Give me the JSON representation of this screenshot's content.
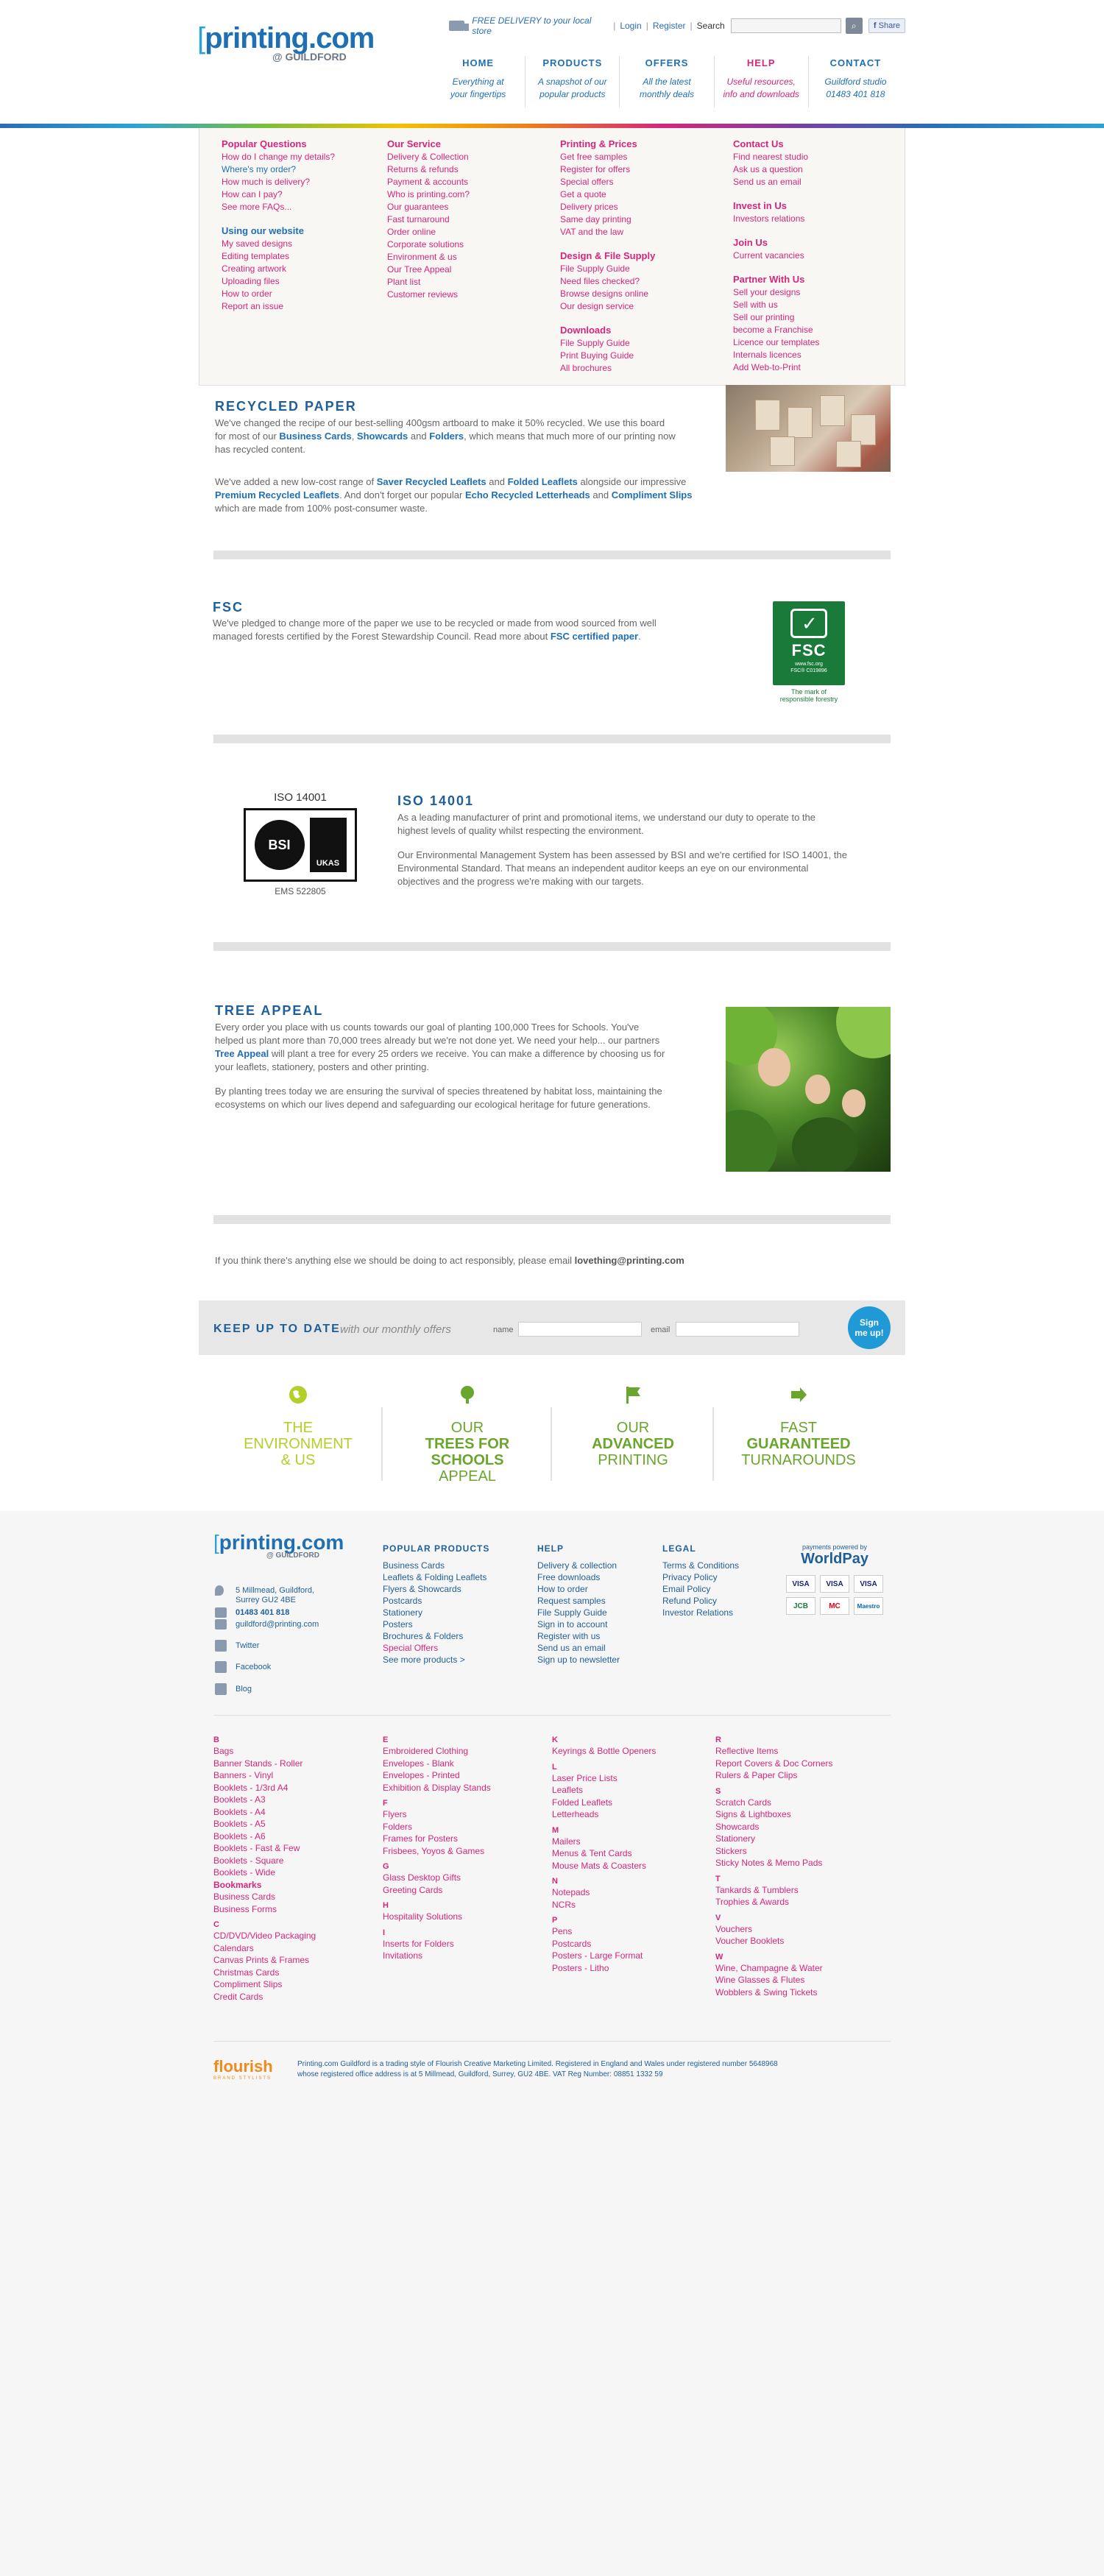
{
  "header": {
    "delivery": "FREE DELIVERY to your local store",
    "login": "Login",
    "register": "Register",
    "search_label": "Search",
    "share": "Share",
    "logo_word": "printing.com",
    "logo_bracket": "[",
    "logo_sub": "@ GUILDFORD"
  },
  "nav": [
    {
      "title": "HOME",
      "sub1": "Everything at",
      "sub2": "your fingertips"
    },
    {
      "title": "PRODUCTS",
      "sub1": "A snapshot of our",
      "sub2": "popular products"
    },
    {
      "title": "OFFERS",
      "sub1": "All the latest",
      "sub2": "monthly deals"
    },
    {
      "title": "HELP",
      "sub1": "Useful resources,",
      "sub2": "info and downloads"
    },
    {
      "title": "CONTACT",
      "sub1": "Guildford studio",
      "sub2": "01483 401 818"
    }
  ],
  "mega": {
    "popular_title": "Popular Questions",
    "popular": [
      "How do I change my details?",
      "Where's my order?",
      "How much is delivery?",
      "How can I pay?",
      "See more FAQs..."
    ],
    "website_title": "Using our website",
    "website": [
      "My saved designs",
      "Editing templates",
      "Creating artwork",
      "Uploading files",
      "How to order",
      "Report an issue"
    ],
    "service_title": "Our Service",
    "service": [
      "Delivery & Collection",
      "Returns & refunds",
      "Payment & accounts",
      "Who is printing.com?",
      "Our guarantees",
      "Fast turnaround",
      "Order online",
      "Corporate solutions",
      "Environment & us",
      "Our Tree Appeal",
      "Plant list",
      "Customer reviews"
    ],
    "prices_title": "Printing & Prices",
    "prices": [
      "Get free samples",
      "Register for offers",
      "Special offers",
      "Get a quote",
      "Delivery prices",
      "Same day printing",
      "VAT and the law"
    ],
    "design_title": "Design & File Supply",
    "design": [
      "File Supply Guide",
      "Need files checked?",
      "Browse designs online",
      "Our design service"
    ],
    "downloads_title": "Downloads",
    "downloads": [
      "File Supply Guide",
      "Print Buying Guide",
      "All brochures"
    ],
    "contact_title": "Contact Us",
    "contact": [
      "Find nearest studio",
      "Ask us a question",
      "Send us an email"
    ],
    "invest_title": "Invest in Us",
    "invest": [
      "Investors relations"
    ],
    "join_title": "Join Us",
    "join": [
      "Current vacancies"
    ],
    "partner_title": "Partner With Us",
    "partner": [
      "Sell your designs",
      "Sell with us",
      "Sell our printing",
      "become a Franchise",
      "Licence our templates",
      "Internals licences",
      "Add Web-to-Print"
    ]
  },
  "recycled": {
    "title": "RECYCLED PAPER",
    "p1a": "We've changed the recipe of our best-selling 400gsm artboard to make it 50% recycled. We use this board",
    "p1b": "for most of our ",
    "l1": "Business Cards",
    "c1": ", ",
    "l2": "Showcards",
    "c2": " and ",
    "l3": "Folders",
    "p1c": ", which means that much more of our printing now",
    "p1d": "has recycled content.",
    "p2a": "We've added a new low-cost range of ",
    "l4": "Saver Recycled Leaflets",
    "c3": " and ",
    "l5": "Folded Leaflets",
    "p2b": " alongside our impressive",
    "l6": "Premium Recycled Leaflets",
    "p2c": ". And don't forget our popular ",
    "l7": "Echo Recycled Letterheads",
    "c4": " and ",
    "l8": "Compliment Slips",
    "p2d": "which are made from 100% post-consumer waste."
  },
  "fsc": {
    "title": "FSC",
    "p1": "We've pledged to change more of the paper we use to be recycled or made from wood sourced from well",
    "p2a": "managed forests certified by the Forest Stewardship Council. Read more about ",
    "link": "FSC certified paper",
    "p2b": ".",
    "logo_text": "FSC",
    "logo_small": "www.fsc.org",
    "logo_code": "FSC® C019896",
    "caption1": "The mark of",
    "caption2": "responsible forestry"
  },
  "iso": {
    "title": "ISO 14001",
    "logo_caption": "ISO 14001",
    "logo_bsi": "BSI",
    "logo_ukas": "UKAS",
    "ems": "EMS 522805",
    "p1a": "As a leading manufacturer of print and promotional items, we understand our duty to operate to the",
    "p1b": "highest levels of quality whilst respecting the environment.",
    "p2a": "Our Environmental Management System has been assessed by BSI and we're certified for ISO 14001, the",
    "p2b": "Environmental Standard. That means an independent auditor keeps an eye on our environmental",
    "p2c": "objectives and the progress we're making with our targets."
  },
  "tree": {
    "title": "TREE APPEAL",
    "p1a": "Every order you place with us counts towards our goal of planting 100,000 Trees for Schools. You've",
    "p1b": "helped us plant more than 70,000 trees already but we're not done yet. We need your help... our partners",
    "link": "Tree Appeal",
    "p1c": " will plant a tree for every 25 orders we receive. You can make a difference by choosing us for",
    "p1d": "your leaflets, stationery, posters and other printing.",
    "p2a": "By planting trees today we are ensuring the survival of species threatened by habitat loss, maintaining the",
    "p2b": "ecosystems on which our lives depend and safeguarding our ecological heritage for future generations."
  },
  "email_note": {
    "text": "If you think there's anything else we should be doing to act responsibly, please email ",
    "email": "lovething@printing.com"
  },
  "newsletter": {
    "title": "KEEP UP TO DATE",
    "sub": "with our monthly offers",
    "name_label": "name",
    "email_label": "email",
    "button1": "Sign",
    "button2": "me up!"
  },
  "features": [
    {
      "l1": "THE",
      "l2": "ENVIRONMENT",
      "l3": "& US",
      "color": "#b3cf2a"
    },
    {
      "l1": "OUR",
      "l2": "TREES FOR",
      "l3": "SCHOOLS",
      "l4": "APPEAL",
      "color": "#6aa52e"
    },
    {
      "l1": "OUR",
      "l2": "ADVANCED",
      "l3": "PRINTING",
      "color": "#6aa52e"
    },
    {
      "l1": "FAST",
      "l2": "GUARANTEED",
      "l3": "TURNAROUNDS",
      "color": "#6aa52e"
    }
  ],
  "footer": {
    "logo_word": "printing.com",
    "logo_bracket": "[",
    "logo_sub": "@ GUILDFORD",
    "address1": "5 Millmead, Guildford,",
    "address2": "Surrey GU2 4BE",
    "phone": "01483 401 818",
    "email": "guildford@printing.com",
    "twitter": "Twitter",
    "facebook": "Facebook",
    "blog": "Blog",
    "popular_title": "POPULAR PRODUCTS",
    "popular": [
      "Business Cards",
      "Leaflets & Folding Leaflets",
      "Flyers & Showcards",
      "Postcards",
      "Stationery",
      "Posters",
      "Brochures & Folders",
      "Special Offers",
      "See more products >"
    ],
    "help_title": "HELP",
    "help": [
      "Delivery & collection",
      "Free downloads",
      "How to order",
      "Request samples",
      "File Supply Guide",
      "Sign in to account",
      "Register with us",
      "Send us an email",
      "Sign up to newsletter"
    ],
    "legal_title": "LEGAL",
    "legal": [
      "Terms & Conditions",
      "Privacy Policy",
      "Email Policy",
      "Refund Policy",
      "Investor Relations"
    ],
    "wp_caption": "payments powered by",
    "wp_name": "WorldPay",
    "cards": [
      "VISA",
      "VISA",
      "VISA",
      "JCB",
      "MC",
      "Maestro"
    ],
    "flourish": "flourish",
    "flourish_sub": "BRAND STYLISTS",
    "legal_text1": "Printing.com Guildford is a trading style of Flourish Creative Marketing Limited. Registered in England and Wales under registered number 5648968",
    "legal_text2": "whose registered office address is at 5 Millmead, Guildford, Surrey, GU2 4BE. VAT Reg Number: 08851 1332 59"
  },
  "az": {
    "col1": [
      {
        "t": "B",
        "h": true
      },
      {
        "t": "Bags"
      },
      {
        "t": "Banner Stands - Roller"
      },
      {
        "t": "Banners - Vinyl"
      },
      {
        "t": "Booklets - 1/3rd A4"
      },
      {
        "t": "Booklets - A3"
      },
      {
        "t": "Booklets - A4"
      },
      {
        "t": "Booklets - A5"
      },
      {
        "t": "Booklets - A6"
      },
      {
        "t": "Booklets - Fast & Few"
      },
      {
        "t": "Booklets - Square"
      },
      {
        "t": "Booklets - Wide"
      },
      {
        "t": "Bookmarks",
        "b": true
      },
      {
        "t": "Business Cards"
      },
      {
        "t": "Business Forms"
      },
      {
        "t": "C",
        "h": true
      },
      {
        "t": "CD/DVD/Video Packaging"
      },
      {
        "t": "Calendars"
      },
      {
        "t": "Canvas Prints & Frames"
      },
      {
        "t": "Christmas Cards"
      },
      {
        "t": "Compliment Slips"
      },
      {
        "t": "Credit Cards"
      }
    ],
    "col2": [
      {
        "t": "E",
        "h": true
      },
      {
        "t": "Embroidered Clothing"
      },
      {
        "t": "Envelopes - Blank"
      },
      {
        "t": "Envelopes - Printed"
      },
      {
        "t": "Exhibition & Display Stands"
      },
      {
        "t": "F",
        "h": true
      },
      {
        "t": "Flyers"
      },
      {
        "t": "Folders"
      },
      {
        "t": "Frames for Posters"
      },
      {
        "t": "Frisbees, Yoyos & Games"
      },
      {
        "t": "G",
        "h": true
      },
      {
        "t": "Glass Desktop Gifts"
      },
      {
        "t": "Greeting Cards"
      },
      {
        "t": "H",
        "h": true
      },
      {
        "t": "Hospitality Solutions"
      },
      {
        "t": "I",
        "h": true
      },
      {
        "t": "Inserts for Folders"
      },
      {
        "t": "Invitations"
      }
    ],
    "col3": [
      {
        "t": "K",
        "h": true
      },
      {
        "t": "Keyrings & Bottle Openers"
      },
      {
        "t": "L",
        "h": true
      },
      {
        "t": "Laser Price Lists"
      },
      {
        "t": "Leaflets"
      },
      {
        "t": "Folded Leaflets"
      },
      {
        "t": "Letterheads"
      },
      {
        "t": "M",
        "h": true
      },
      {
        "t": "Mailers"
      },
      {
        "t": "Menus & Tent Cards"
      },
      {
        "t": "Mouse Mats & Coasters"
      },
      {
        "t": "N",
        "h": true
      },
      {
        "t": "Notepads"
      },
      {
        "t": "NCRs"
      },
      {
        "t": "P",
        "h": true
      },
      {
        "t": "Pens"
      },
      {
        "t": "Postcards"
      },
      {
        "t": "Posters - Large Format"
      },
      {
        "t": "Posters - Litho"
      }
    ],
    "col4": [
      {
        "t": "R",
        "h": true
      },
      {
        "t": "Reflective Items"
      },
      {
        "t": "Report Covers & Doc Corners"
      },
      {
        "t": "Rulers & Paper Clips"
      },
      {
        "t": "S",
        "h": true
      },
      {
        "t": "Scratch Cards"
      },
      {
        "t": "Signs & Lightboxes"
      },
      {
        "t": "Showcards"
      },
      {
        "t": "Stationery"
      },
      {
        "t": "Stickers"
      },
      {
        "t": "Sticky Notes & Memo Pads"
      },
      {
        "t": "T",
        "h": true
      },
      {
        "t": "Tankards & Tumblers"
      },
      {
        "t": "Trophies & Awards"
      },
      {
        "t": "V",
        "h": true
      },
      {
        "t": "Vouchers"
      },
      {
        "t": "Voucher Booklets"
      },
      {
        "t": "W",
        "h": true
      },
      {
        "t": "Wine, Champagne & Water"
      },
      {
        "t": "Wine Glasses & Flutes"
      },
      {
        "t": "Wobblers & Swing Tickets"
      }
    ]
  }
}
